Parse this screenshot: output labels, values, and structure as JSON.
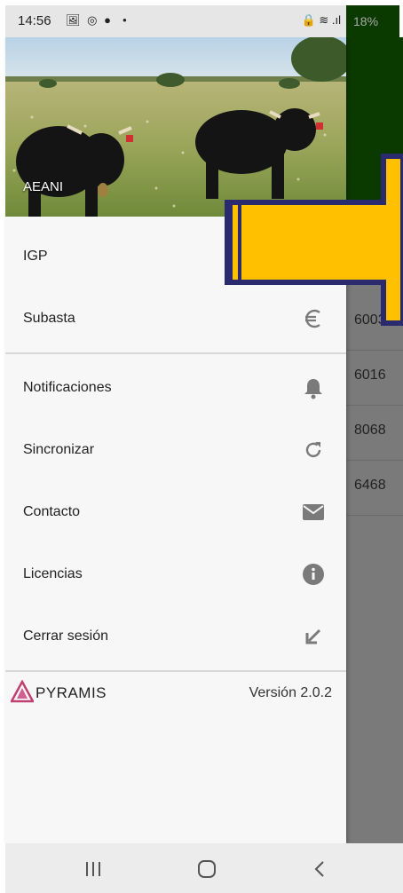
{
  "status_bar": {
    "time": "14:56",
    "left_icons": [
      "gallery-icon",
      "whatsapp-icon",
      "account-icon",
      "dot"
    ],
    "battery_text": "18%"
  },
  "drawer": {
    "header_title": "AEANI",
    "items": [
      {
        "label": "IGP",
        "icon": "none"
      },
      {
        "label": "Subasta",
        "icon": "euro-icon"
      },
      {
        "label": "Notificaciones",
        "icon": "bell-icon"
      },
      {
        "label": "Sincronizar",
        "icon": "refresh-icon"
      },
      {
        "label": "Contacto",
        "icon": "mail-icon"
      },
      {
        "label": "Licencias",
        "icon": "info-icon"
      },
      {
        "label": "Cerrar sesión",
        "icon": "logout-arrow-icon"
      }
    ],
    "footer": {
      "logo_text": "PYRAMIS",
      "version": "Versión 2.0.2"
    }
  },
  "background_list": [
    "6003",
    "6016",
    "8068",
    "6468"
  ],
  "colors": {
    "drawer_bg": "#f7f7f7",
    "arrow_fill": "#ffc000",
    "arrow_stroke": "#2a2a6e",
    "bg_header": "#0b3a00",
    "icon_gray": "#7a7a7a"
  }
}
